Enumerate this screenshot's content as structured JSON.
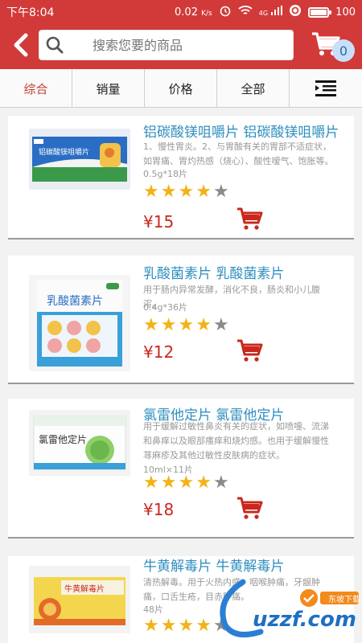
{
  "status_bar": {
    "time": "下午8:04",
    "network_speed": "0.02",
    "network_unit": "K/s",
    "network_type": "4G",
    "battery_level": "100"
  },
  "header": {
    "search_placeholder": "搜索您要的商品",
    "cart_count": "0"
  },
  "tabs": [
    {
      "label": "综合",
      "active": true
    },
    {
      "label": "销量",
      "active": false
    },
    {
      "label": "价格",
      "active": false
    },
    {
      "label": "全部",
      "active": false
    }
  ],
  "products": [
    {
      "name": "铝碳酸镁咀嚼片 铝碳酸镁咀嚼片",
      "desc": "1、慢性胃炎。2、与胃酸有关的胃部不适症状，如胃痛、胃灼热感（烧心）、酸性嗳气、饱胀等。",
      "spec": "0.5g*18片",
      "rating": 4,
      "price": "¥15",
      "box_label": "铝碳酸镁咀嚼片"
    },
    {
      "name": "乳酸菌素片 乳酸菌素片",
      "desc": "用于肠内异常发酵，消化不良，肠炎和小儿腹泻。",
      "spec": "0.4g*36片",
      "rating": 4,
      "price": "¥12",
      "box_label": "乳酸菌素片"
    },
    {
      "name": "氯雷他定片 氯雷他定片",
      "desc": "用于缓解过敏性鼻炎有关的症状，如喷嚏、流涕和鼻痒以及眼部瘙痒和烧灼感。也用于缓解慢性荨麻疹及其他过敏性皮肤病的症状。",
      "spec": "10ml×11片",
      "rating": 4,
      "price": "¥18",
      "box_label": "氯雷他定片"
    },
    {
      "name": "牛黄解毒片 牛黄解毒片",
      "desc": "清热解毒。用于火热内盛，咽喉肿痛，牙龈肿痛，口舌生疮，目赤肿痛。",
      "spec": "48片",
      "rating": 4,
      "price": "",
      "box_label": "牛黄解毒片"
    }
  ],
  "watermark": {
    "text": "uzzf.com",
    "badge": "东坡下载"
  },
  "colors": {
    "header_red": "#d23a3a",
    "price_red": "#c8281e",
    "name_blue": "#2f8fbf",
    "star_gold": "#f2b318"
  }
}
